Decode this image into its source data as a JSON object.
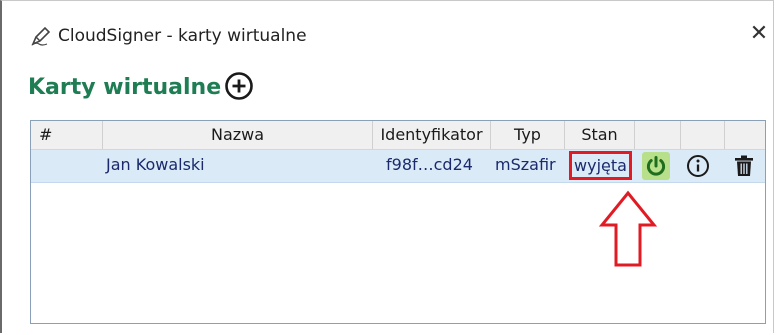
{
  "window": {
    "title": "CloudSigner - karty wirtualne",
    "close_glyph": "✕"
  },
  "heading": "Karty wirtualne",
  "table": {
    "columns": [
      "#",
      "Nazwa",
      "Identyfikator",
      "Typ",
      "Stan"
    ],
    "rows": [
      {
        "number": "",
        "name": "Jan Kowalski",
        "id": "f98f…cd24",
        "type": "mSzafir",
        "status": "wyjęta"
      }
    ]
  },
  "icons": {
    "app": "pen-icon",
    "add": "plus-circle-icon",
    "power": "power-icon",
    "info": "info-icon",
    "delete": "trash-icon",
    "annotation": "up-arrow-icon"
  },
  "colors": {
    "heading": "#1e7d52",
    "row_selected": "#dbeaf7",
    "highlight": "#e01b24",
    "power_bg": "#b8e08a",
    "power_icon": "#1f6e1f"
  }
}
